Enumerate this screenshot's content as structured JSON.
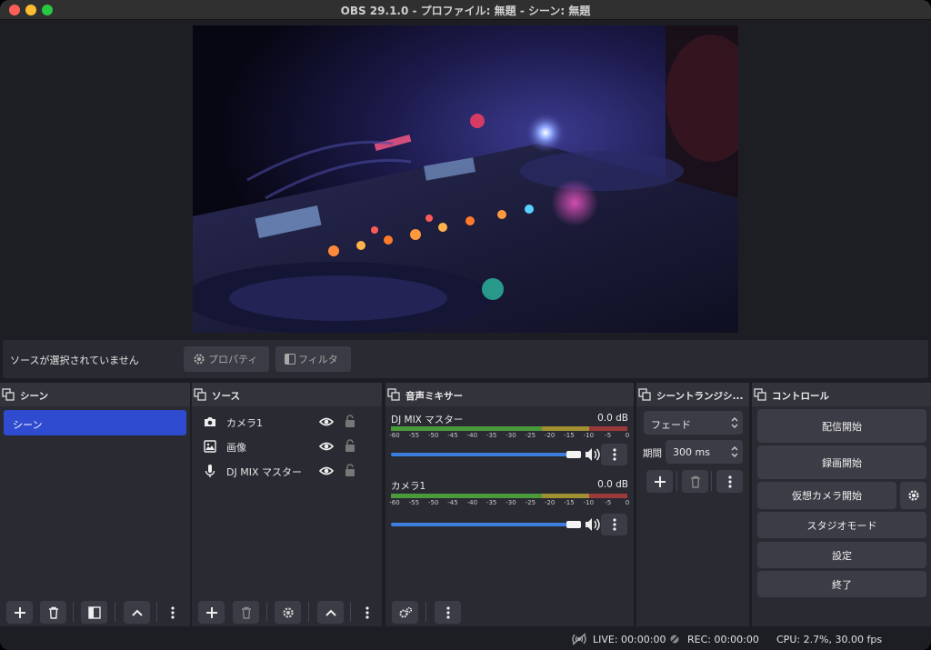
{
  "window": {
    "title": "OBS 29.1.0 - プロファイル: 無題 - シーン: 無題"
  },
  "context_bar": {
    "no_source_label": "ソースが選択されていません",
    "properties_label": "プロパティ",
    "filters_label": "フィルタ"
  },
  "scenes": {
    "title": "シーン",
    "items": [
      {
        "label": "シーン",
        "selected": true
      }
    ]
  },
  "sources": {
    "title": "ソース",
    "items": [
      {
        "label": "カメラ1",
        "icon": "camera-icon"
      },
      {
        "label": "画像",
        "icon": "image-icon"
      },
      {
        "label": "DJ MIX マスター",
        "icon": "microphone-icon"
      }
    ]
  },
  "mixer": {
    "title": "音声ミキサー",
    "scale": [
      "-60",
      "-55",
      "-50",
      "-45",
      "-40",
      "-35",
      "-30",
      "-25",
      "-20",
      "-15",
      "-10",
      "-5",
      "0"
    ],
    "channels": [
      {
        "name": "DJ MIX マスター",
        "db": "0.0 dB",
        "volume": 1.0
      },
      {
        "name": "カメラ1",
        "db": "0.0 dB",
        "volume": 1.0
      }
    ]
  },
  "transitions": {
    "title": "シーントランジシ...",
    "transition": "フェード",
    "duration_label": "期間",
    "duration_value": "300 ms"
  },
  "controls": {
    "title": "コントロール",
    "start_streaming": "配信開始",
    "start_recording": "録画開始",
    "start_virtual_camera": "仮想カメラ開始",
    "studio_mode": "スタジオモード",
    "settings": "設定",
    "exit": "終了"
  },
  "status": {
    "live": "LIVE: 00:00:00",
    "rec": "REC: 00:00:00",
    "cpu": "CPU: 2.7%, 30.00 fps"
  },
  "colors": {
    "accent": "#2f4bd0",
    "meter_green": "#4a9a3c",
    "meter_yellow": "#a19032",
    "meter_red": "#9b3a3a",
    "slider": "#3d7de0"
  }
}
